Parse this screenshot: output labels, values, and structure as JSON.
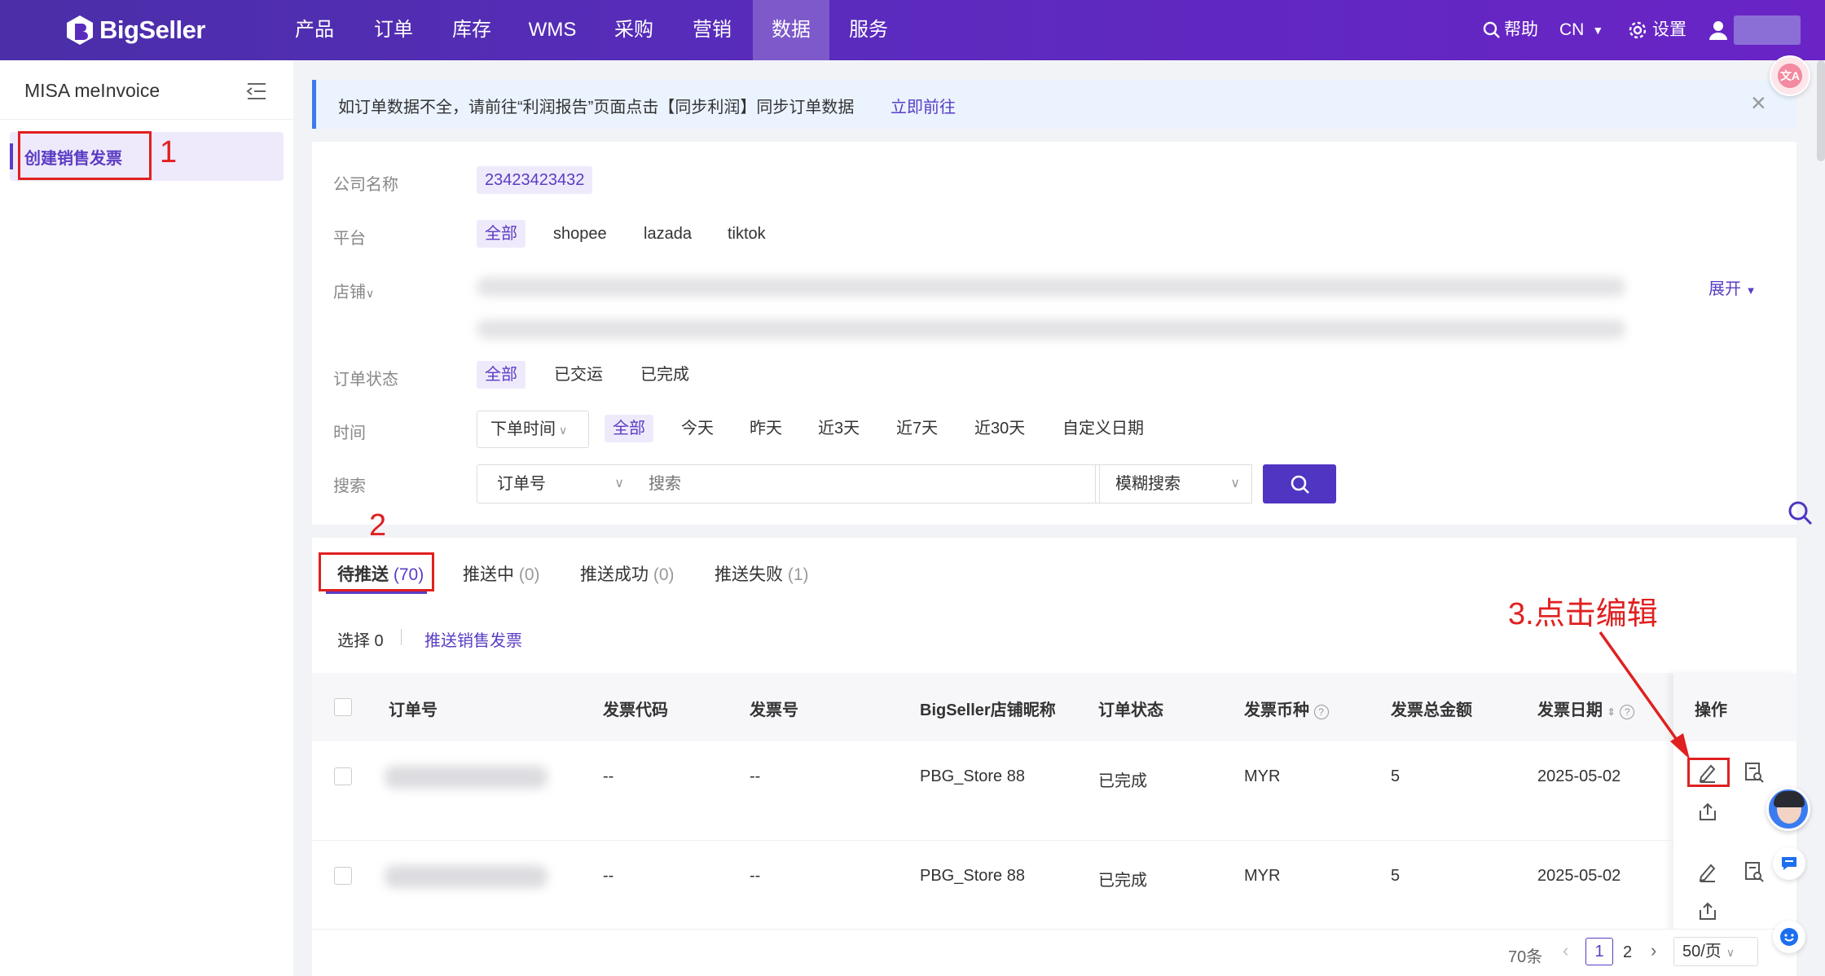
{
  "topnav": {
    "brand": "BigSeller",
    "items": [
      "产品",
      "订单",
      "库存",
      "WMS",
      "采购",
      "营销",
      "数据",
      "服务"
    ],
    "active_index": 6,
    "help": "帮助",
    "lang": "CN",
    "settings": "设置"
  },
  "sidebar": {
    "title": "MISA meInvoice",
    "items": [
      {
        "label": "创建销售发票",
        "active": true
      }
    ]
  },
  "notice": {
    "text": "如订单数据不全，请前往“利润报告”页面点击【同步利润】同步订单数据",
    "link": "立即前往"
  },
  "filters": {
    "company_label": "公司名称",
    "company_value": "23423423432",
    "platform_label": "平台",
    "platforms": [
      "全部",
      "shopee",
      "lazada",
      "tiktok"
    ],
    "store_label": "店铺",
    "expand": "展开",
    "status_label": "订单状态",
    "statuses": [
      "全部",
      "已交运",
      "已完成"
    ],
    "time_label": "时间",
    "time_type": "下单时间",
    "time_options": [
      "全部",
      "今天",
      "昨天",
      "近3天",
      "近7天",
      "近30天",
      "自定义日期"
    ],
    "search_label": "搜索",
    "search_field": "订单号",
    "search_placeholder": "搜索",
    "search_mode": "模糊搜索"
  },
  "tabs": [
    {
      "label": "待推送",
      "count": "(70)"
    },
    {
      "label": "推送中",
      "count": "(0)"
    },
    {
      "label": "推送成功",
      "count": "(0)"
    },
    {
      "label": "推送失败",
      "count": "(1)"
    }
  ],
  "toolbar": {
    "selected": "选择 0",
    "push": "推送销售发票"
  },
  "table": {
    "columns": [
      "订单号",
      "发票代码",
      "发票号",
      "BigSeller店铺昵称",
      "订单状态",
      "发票币种",
      "发票总金额",
      "发票日期",
      "操作"
    ],
    "rows": [
      {
        "code": "--",
        "number": "--",
        "store": "PBG_Store 88",
        "status": "已完成",
        "currency": "MYR",
        "amount": "5",
        "date": "2025-05-02"
      },
      {
        "code": "--",
        "number": "--",
        "store": "PBG_Store 88",
        "status": "已完成",
        "currency": "MYR",
        "amount": "5",
        "date": "2025-05-02"
      }
    ]
  },
  "pagination": {
    "total": "70条",
    "pages": [
      "1",
      "2"
    ],
    "page_size": "50/页"
  },
  "annotations": {
    "step1": "1",
    "step2": "2",
    "step3": "3.点击编辑"
  }
}
